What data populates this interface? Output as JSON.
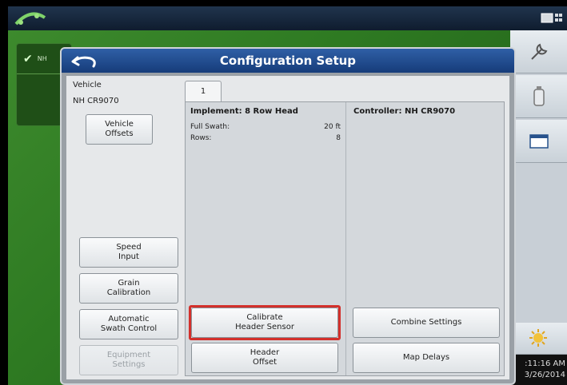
{
  "dialog": {
    "title": "Configuration Setup"
  },
  "vehicle": {
    "label": "Vehicle",
    "name": "NH CR9070"
  },
  "left_buttons": {
    "vehicle_offsets": "Vehicle\nOffsets",
    "speed_input": "Speed\nInput",
    "grain_calibration": "Grain\nCalibration",
    "automatic_swath_control": "Automatic\nSwath Control",
    "equipment_settings": "Equipment\nSettings"
  },
  "tabs": [
    {
      "label": "1"
    }
  ],
  "implement": {
    "title": "Implement: 8 Row Head",
    "rows": [
      {
        "label": "Full Swath:",
        "value": "20 ft"
      },
      {
        "label": "Rows:",
        "value": "8"
      }
    ]
  },
  "controller": {
    "title": "Controller: NH CR9070"
  },
  "bottom_buttons": {
    "calibrate_header_sensor": "Calibrate\nHeader Sensor",
    "header_offset": "Header\nOffset",
    "combine_settings": "Combine Settings",
    "map_delays": "Map Delays"
  },
  "background": {
    "item_text": "NH"
  },
  "status": {
    "time": ":11:16 AM",
    "date": "3/26/2014"
  },
  "colors": {
    "title_bar": "#163c7a",
    "highlight": "#d3302b",
    "field_green": "#2e7a22"
  }
}
